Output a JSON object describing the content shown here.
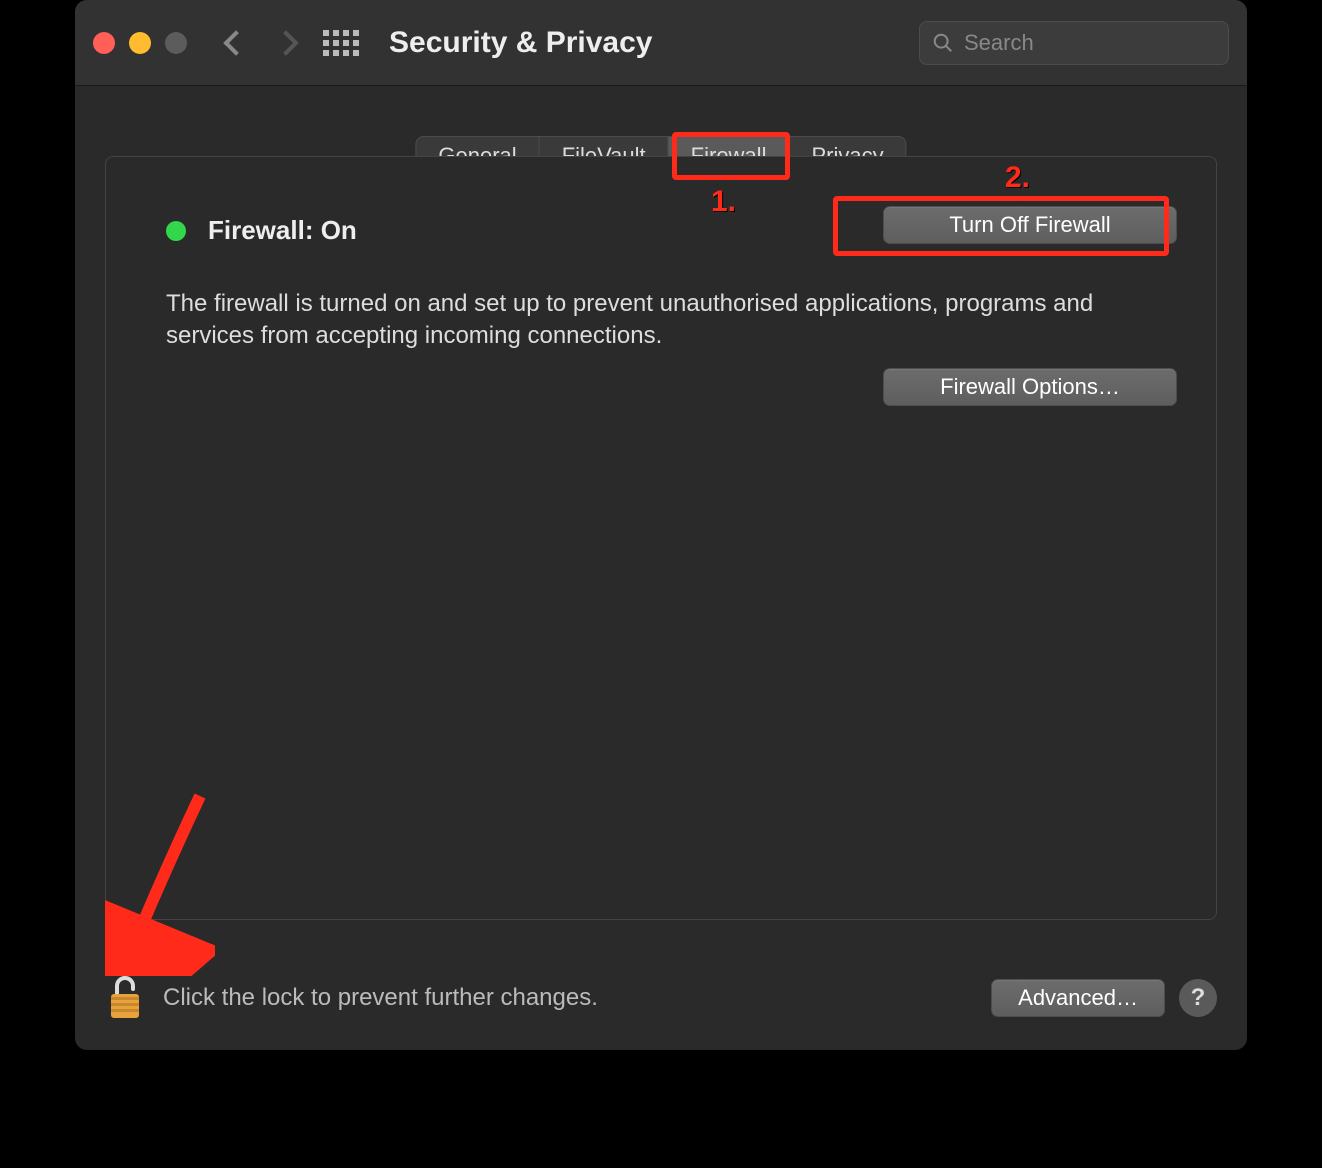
{
  "window": {
    "title": "Security & Privacy"
  },
  "search": {
    "placeholder": "Search",
    "value": ""
  },
  "tabs": [
    {
      "label": "General",
      "active": false
    },
    {
      "label": "FileVault",
      "active": false
    },
    {
      "label": "Firewall",
      "active": true
    },
    {
      "label": "Privacy",
      "active": false
    }
  ],
  "firewall": {
    "status_label": "Firewall: On",
    "status_color": "#32d74b",
    "description": "The firewall is turned on and set up to prevent unauthorised applications, programs and services from accepting incoming connections.",
    "turn_off_label": "Turn Off Firewall",
    "options_label": "Firewall Options…"
  },
  "footer": {
    "lock_text": "Click the lock to prevent further changes.",
    "advanced_label": "Advanced…",
    "help_label": "?"
  },
  "annotations": {
    "callout1": "1.",
    "callout2": "2."
  }
}
